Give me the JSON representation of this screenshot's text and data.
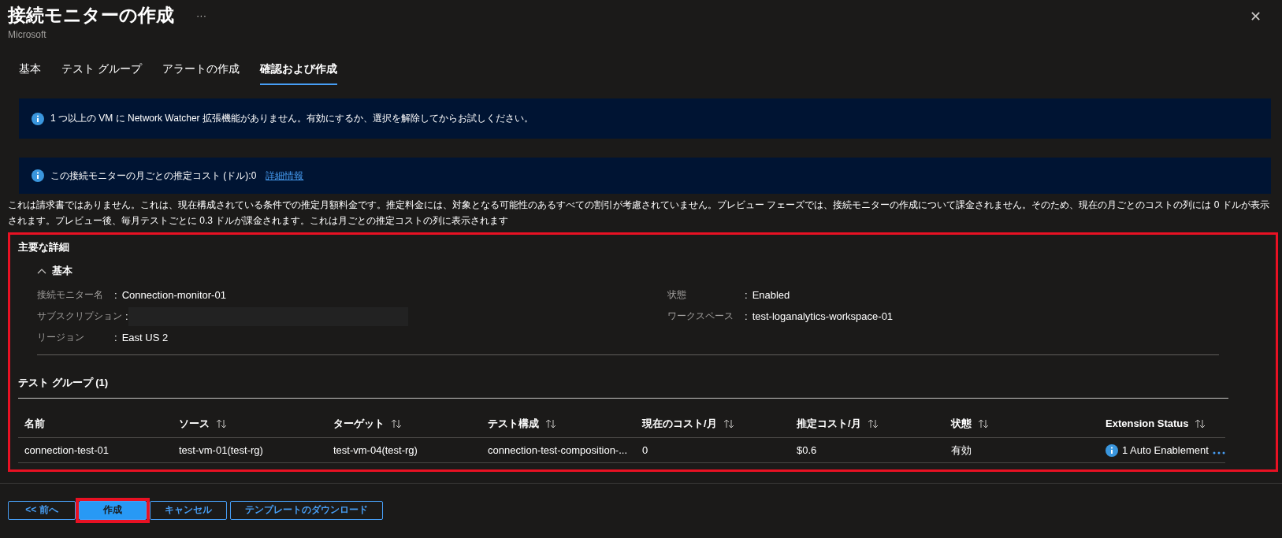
{
  "header": {
    "title": "接続モニターの作成",
    "more": "···",
    "subtitle": "Microsoft",
    "close": "✕"
  },
  "tabs": [
    {
      "label": "基本",
      "selected": false
    },
    {
      "label": "テスト グループ",
      "selected": false
    },
    {
      "label": "アラートの作成",
      "selected": false
    },
    {
      "label": "確認および作成",
      "selected": true
    }
  ],
  "banners": [
    {
      "text": "1 つ以上の VM に Network Watcher 拡張機能がありません。有効にするか、選択を解除してからお試しください。"
    },
    {
      "text": "この接続モニターの月ごとの推定コスト (ドル):0",
      "link": "詳細情報"
    }
  ],
  "disclaimer": "これは請求書ではありません。これは、現在構成されている条件での推定月額料金です。推定料金には、対象となる可能性のあるすべての割引が考慮されていません。プレビュー フェーズでは、接続モニターの作成について課金されません。そのため、現在の月ごとのコストの列には 0 ドルが表示されます。プレビュー後、毎月テストごとに 0.3 ドルが課金されます。これは月ごとの推定コストの列に表示されます",
  "details": {
    "highlighted": true,
    "title": "主要な詳細",
    "basics": {
      "title": "基本",
      "expanded": true,
      "left": [
        {
          "label": "接続モニター名",
          "sep": ":",
          "value": "Connection-monitor-01"
        },
        {
          "label": "サブスクリプション",
          "sep": ":",
          "redacted": true
        },
        {
          "label": "リージョン",
          "sep": ":",
          "value": "East US 2"
        }
      ],
      "right": [
        {
          "label": "状態",
          "sep": ":",
          "value": "Enabled"
        },
        {
          "label": "ワークスペース",
          "sep": ":",
          "value": "test-loganalytics-workspace-01"
        }
      ]
    },
    "test_groups": {
      "title": "テスト グループ (1)",
      "columns": [
        {
          "label": "名前",
          "sortable": false
        },
        {
          "label": "ソース",
          "sortable": true
        },
        {
          "label": "ターゲット",
          "sortable": true
        },
        {
          "label": "テスト構成",
          "sortable": true
        },
        {
          "label": "現在のコスト/月",
          "sortable": true
        },
        {
          "label": "推定コスト/月",
          "sortable": true
        },
        {
          "label": "状態",
          "sortable": true
        },
        {
          "label": "Extension Status",
          "sortable": true
        }
      ],
      "rows": [
        {
          "cells": [
            "connection-test-01",
            "test-vm-01(test-rg)",
            "test-vm-04(test-rg)",
            "connection-test-composition-...",
            "0",
            "$0.6",
            "有効"
          ],
          "extension_status": "1 Auto Enablement"
        }
      ]
    }
  },
  "footer": {
    "buttons": [
      {
        "label": "<< 前へ",
        "primary": false,
        "highlighted": false
      },
      {
        "label": "作成",
        "primary": true,
        "highlighted": true
      },
      {
        "label": "キャンセル",
        "primary": false,
        "highlighted": false
      },
      {
        "label": "テンプレートのダウンロード",
        "primary": false,
        "highlighted": false
      }
    ]
  }
}
